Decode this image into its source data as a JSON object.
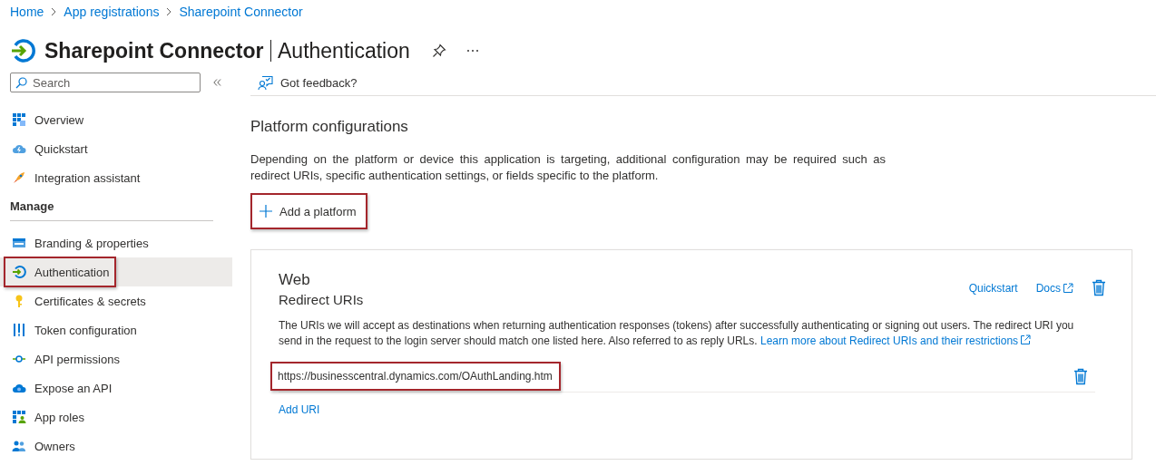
{
  "breadcrumb": [
    {
      "label": "Home"
    },
    {
      "label": "App registrations"
    },
    {
      "label": "Sharepoint Connector"
    }
  ],
  "header": {
    "title": "Sharepoint Connector",
    "subtitle": "Authentication"
  },
  "sidebar": {
    "search": {
      "placeholder": "Search"
    },
    "sections": [
      {
        "items": [
          {
            "label": "Overview",
            "selected": false,
            "highlighted": false
          },
          {
            "label": "Quickstart",
            "selected": false,
            "highlighted": false
          },
          {
            "label": "Integration assistant",
            "selected": false,
            "highlighted": false
          }
        ]
      },
      {
        "heading": "Manage",
        "items": [
          {
            "label": "Branding & properties",
            "selected": false,
            "highlighted": false
          },
          {
            "label": "Authentication",
            "selected": true,
            "highlighted": true
          },
          {
            "label": "Certificates & secrets",
            "selected": false,
            "highlighted": false
          },
          {
            "label": "Token configuration",
            "selected": false,
            "highlighted": false
          },
          {
            "label": "API permissions",
            "selected": false,
            "highlighted": false
          },
          {
            "label": "Expose an API",
            "selected": false,
            "highlighted": false
          },
          {
            "label": "App roles",
            "selected": false,
            "highlighted": false
          },
          {
            "label": "Owners",
            "selected": false,
            "highlighted": false
          }
        ]
      }
    ]
  },
  "main": {
    "toolbar": [
      {
        "label": "Got feedback?"
      }
    ],
    "heading": "Platform configurations",
    "description": "Depending on the platform or device this application is targeting, additional configuration may be required such as redirect URIs, specific authentication settings, or fields specific to the platform.",
    "add_button": {
      "label": "Add a platform",
      "highlighted": true
    },
    "platform": {
      "title": "Web",
      "links": [
        {
          "label": "Quickstart",
          "external": false
        },
        {
          "label": "Docs",
          "external": true
        }
      ],
      "section_title": "Redirect URIs",
      "description": "The URIs we will accept as destinations when returning authentication responses (tokens) after successfully authenticating or signing out users. The redirect URI you send in the request to the login server should match one listed here. Also referred to as reply URLs.",
      "learn_more": "Learn more about Redirect URIs and their restrictions",
      "uris": [
        {
          "value": "https://businesscentral.dynamics.com/OAuthLanding.htm",
          "highlighted": true
        }
      ],
      "add_uri": "Add URI"
    }
  }
}
